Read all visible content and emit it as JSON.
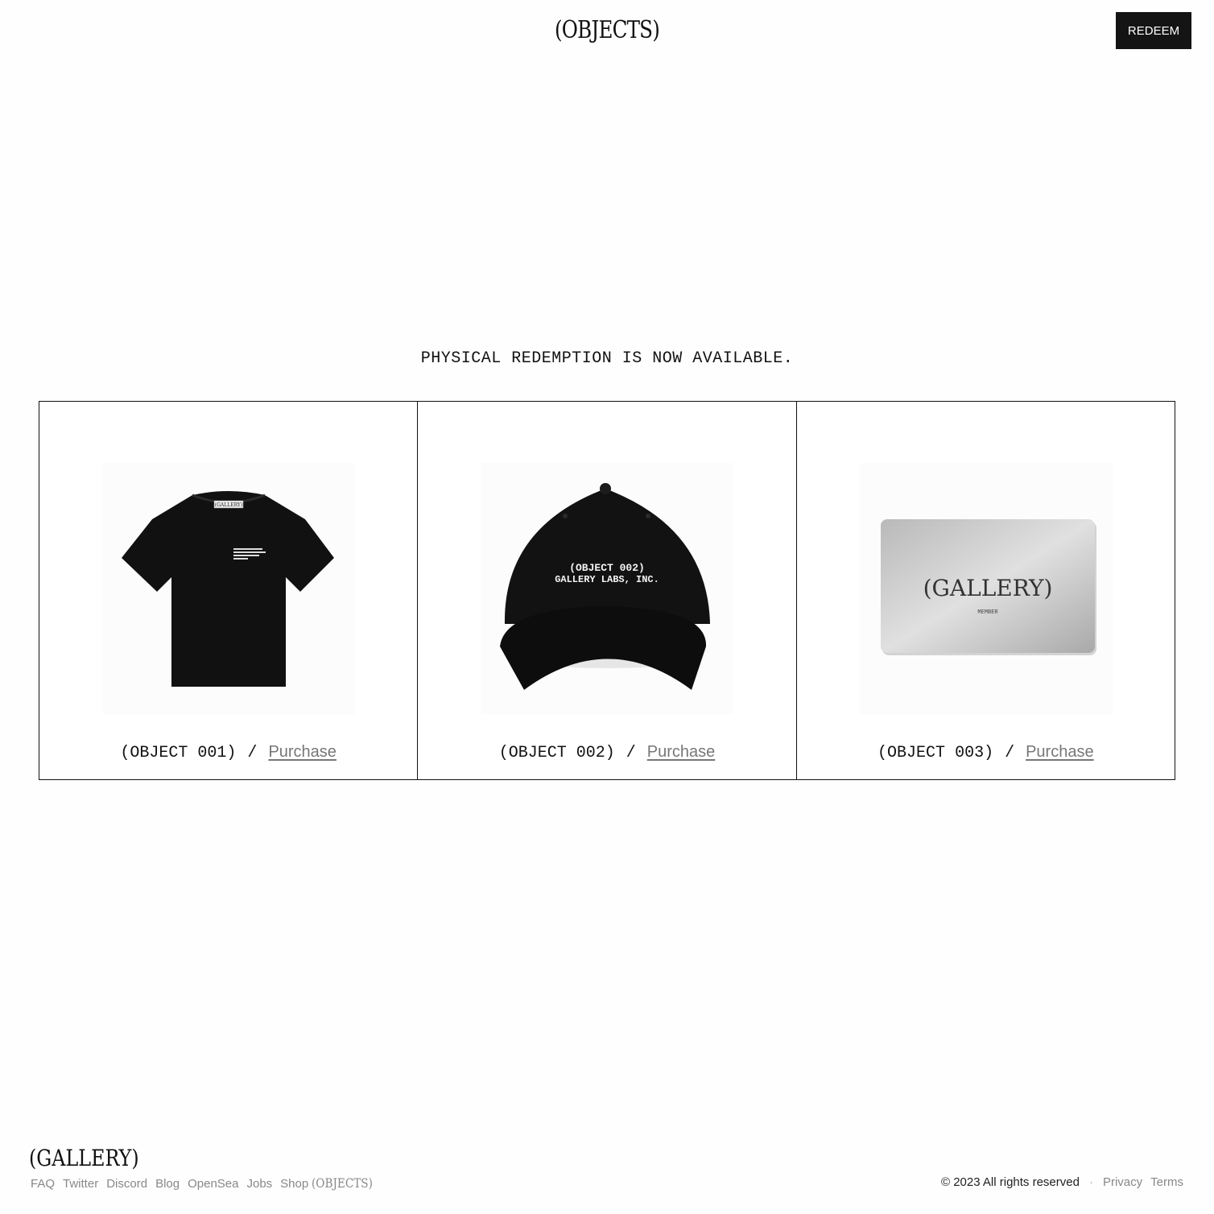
{
  "header": {
    "logo": "(OBJECTS)",
    "redeem_label": "REDEEM"
  },
  "main": {
    "announcement": "PHYSICAL REDEMPTION IS NOW AVAILABLE.",
    "products": [
      {
        "label": "(OBJECT 001)",
        "separator": "/",
        "link": "Purchase",
        "image_icon": "tshirt-image",
        "print_text": "(GALLERY)"
      },
      {
        "label": "(OBJECT 002)",
        "separator": "/",
        "link": "Purchase",
        "image_icon": "cap-image",
        "print_line1": "(OBJECT 002)",
        "print_line2": "GALLERY LABS, INC."
      },
      {
        "label": "(OBJECT 003)",
        "separator": "/",
        "link": "Purchase",
        "image_icon": "card-image",
        "print_line1": "(GALLERY)",
        "print_line2": "MEMBER"
      }
    ]
  },
  "footer": {
    "logo": "(GALLERY)",
    "nav": [
      "FAQ",
      "Twitter",
      "Discord",
      "Blog",
      "OpenSea",
      "Jobs",
      "Shop"
    ],
    "shop_brand": "(OBJECTS)",
    "copyright": "© 2023 All rights reserved",
    "dot": "·",
    "privacy": "Privacy",
    "terms": "Terms"
  },
  "colors": {
    "background": "#fefefe",
    "button_bg": "#141414",
    "link_gray": "#777777",
    "card_silver": "#c8c8c8"
  }
}
